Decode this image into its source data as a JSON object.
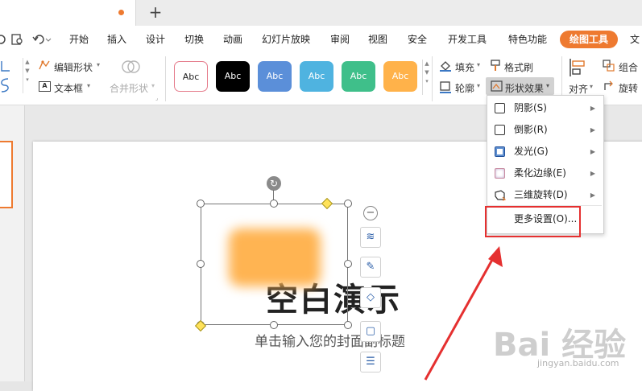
{
  "tabbar": {
    "new_tab": "+"
  },
  "menu": {
    "items": [
      "开始",
      "插入",
      "设计",
      "切换",
      "动画",
      "幻灯片放映",
      "审阅",
      "视图",
      "安全",
      "开发工具",
      "特色功能"
    ],
    "active": "绘图工具",
    "cut_item": "文"
  },
  "ribbon": {
    "edit_shape": "编辑形状",
    "text_box": "文本框",
    "merge_shape": "合并形状",
    "styles": [
      "Abc",
      "Abc",
      "Abc",
      "Abc",
      "Abc",
      "Abc"
    ],
    "style_colors": [
      "#ffffff",
      "#000000",
      "#5b8fd9",
      "#4fb3e0",
      "#3fbf8a",
      "#ffb24a"
    ],
    "fill": "填充",
    "format_painter": "格式刷",
    "outline": "轮廓",
    "shape_effect": "形状效果",
    "align": "对齐",
    "group": "组合",
    "rotate": "旋转"
  },
  "dropdown": {
    "items": [
      {
        "label": "阴影(S)",
        "icon": "shadow-icon"
      },
      {
        "label": "倒影(R)",
        "icon": "reflection-icon"
      },
      {
        "label": "发光(G)",
        "icon": "glow-icon"
      },
      {
        "label": "柔化边缘(E)",
        "icon": "soft-edge-icon"
      },
      {
        "label": "三维旋转(D)",
        "icon": "3d-rotation-icon"
      }
    ],
    "more": "更多设置(O)..."
  },
  "slide": {
    "title": "空白演示",
    "subtitle": "单击输入您的封面副标题"
  },
  "watermark": {
    "text": "Bai  经验",
    "url": "jingyan.baidu.com"
  },
  "colors": {
    "accent": "#ee7a30",
    "annotation": "#e53030",
    "glow": "#ffb452"
  }
}
